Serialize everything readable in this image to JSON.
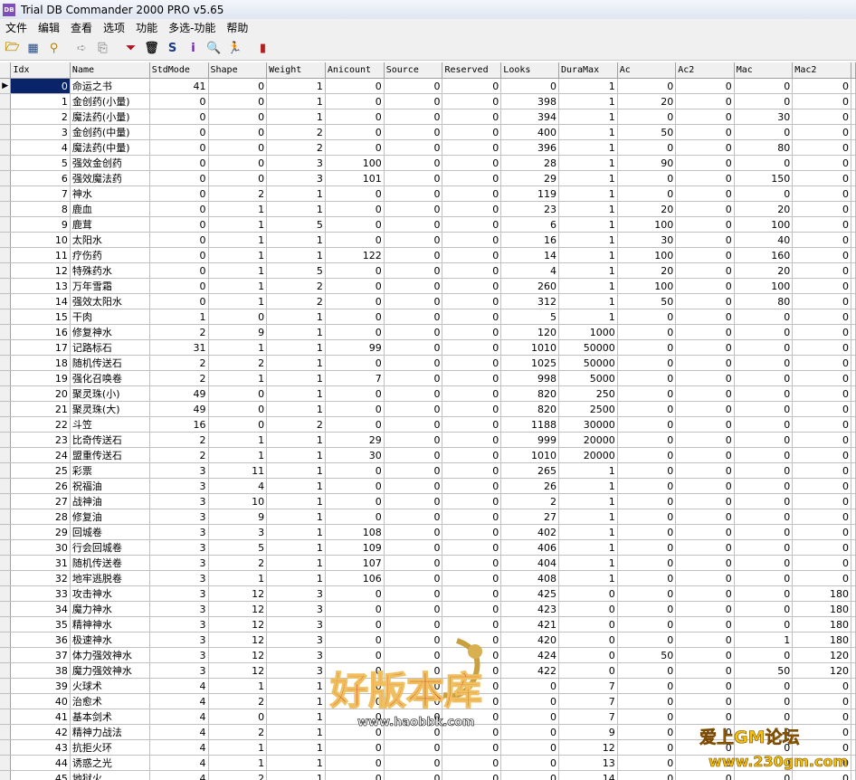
{
  "window": {
    "title": "Trial DB Commander 2000 PRO v5.65",
    "icon": "db-app-icon"
  },
  "menu": [
    "文件",
    "编辑",
    "查看",
    "选项",
    "功能",
    "多选-功能",
    "帮助"
  ],
  "toolbar": [
    {
      "name": "open-folder-icon",
      "glyph": "🗁",
      "color": "#c09000"
    },
    {
      "name": "table-icon",
      "glyph": "▦",
      "color": "#1a4a9a"
    },
    {
      "name": "binoculars-icon",
      "glyph": "⚲",
      "color": "#b08000"
    },
    {
      "name": "arrow-right-icon",
      "glyph": "➪",
      "color": "#a0a0a0"
    },
    {
      "name": "export-icon",
      "glyph": "⎘",
      "color": "#a0a0a0"
    },
    {
      "name": "funnel-icon",
      "glyph": "⏷",
      "color": "#b01020"
    },
    {
      "name": "trash-icon",
      "glyph": "🗑",
      "color": "#202020"
    },
    {
      "name": "sql-icon",
      "glyph": "S",
      "color": "#1a3a8a"
    },
    {
      "name": "info-icon",
      "glyph": "i",
      "color": "#7020b0"
    },
    {
      "name": "search-icon",
      "glyph": "🔍",
      "color": "#1a6a9a"
    },
    {
      "name": "runner-icon",
      "glyph": "🏃",
      "color": "#108030"
    },
    {
      "name": "book-icon",
      "glyph": "▮",
      "color": "#b02020"
    }
  ],
  "columns": [
    "Idx",
    "Name",
    "StdMode",
    "Shape",
    "Weight",
    "Anicount",
    "Source",
    "Reserved",
    "Looks",
    "DuraMax",
    "Ac",
    "Ac2",
    "Mac",
    "Mac2"
  ],
  "rows": [
    [
      "0",
      "命运之书",
      "41",
      "0",
      "1",
      "0",
      "0",
      "0",
      "0",
      "1",
      "0",
      "0",
      "0",
      "0"
    ],
    [
      "1",
      "金创药(小量)",
      "0",
      "0",
      "1",
      "0",
      "0",
      "0",
      "398",
      "1",
      "20",
      "0",
      "0",
      "0"
    ],
    [
      "2",
      "魔法药(小量)",
      "0",
      "0",
      "1",
      "0",
      "0",
      "0",
      "394",
      "1",
      "0",
      "0",
      "30",
      "0"
    ],
    [
      "3",
      "金创药(中量)",
      "0",
      "0",
      "2",
      "0",
      "0",
      "0",
      "400",
      "1",
      "50",
      "0",
      "0",
      "0"
    ],
    [
      "4",
      "魔法药(中量)",
      "0",
      "0",
      "2",
      "0",
      "0",
      "0",
      "396",
      "1",
      "0",
      "0",
      "80",
      "0"
    ],
    [
      "5",
      "强效金创药",
      "0",
      "0",
      "3",
      "100",
      "0",
      "0",
      "28",
      "1",
      "90",
      "0",
      "0",
      "0"
    ],
    [
      "6",
      "强效魔法药",
      "0",
      "0",
      "3",
      "101",
      "0",
      "0",
      "29",
      "1",
      "0",
      "0",
      "150",
      "0"
    ],
    [
      "7",
      "神水",
      "0",
      "2",
      "1",
      "0",
      "0",
      "0",
      "119",
      "1",
      "0",
      "0",
      "0",
      "0"
    ],
    [
      "8",
      "鹿血",
      "0",
      "1",
      "1",
      "0",
      "0",
      "0",
      "23",
      "1",
      "20",
      "0",
      "20",
      "0"
    ],
    [
      "9",
      "鹿茸",
      "0",
      "1",
      "5",
      "0",
      "0",
      "0",
      "6",
      "1",
      "100",
      "0",
      "100",
      "0"
    ],
    [
      "10",
      "太阳水",
      "0",
      "1",
      "1",
      "0",
      "0",
      "0",
      "16",
      "1",
      "30",
      "0",
      "40",
      "0"
    ],
    [
      "11",
      "疗伤药",
      "0",
      "1",
      "1",
      "122",
      "0",
      "0",
      "14",
      "1",
      "100",
      "0",
      "160",
      "0"
    ],
    [
      "12",
      "特殊药水",
      "0",
      "1",
      "5",
      "0",
      "0",
      "0",
      "4",
      "1",
      "20",
      "0",
      "20",
      "0"
    ],
    [
      "13",
      "万年雪霜",
      "0",
      "1",
      "2",
      "0",
      "0",
      "0",
      "260",
      "1",
      "100",
      "0",
      "100",
      "0"
    ],
    [
      "14",
      "强效太阳水",
      "0",
      "1",
      "2",
      "0",
      "0",
      "0",
      "312",
      "1",
      "50",
      "0",
      "80",
      "0"
    ],
    [
      "15",
      "干肉",
      "1",
      "0",
      "1",
      "0",
      "0",
      "0",
      "5",
      "1",
      "0",
      "0",
      "0",
      "0"
    ],
    [
      "16",
      "修复神水",
      "2",
      "9",
      "1",
      "0",
      "0",
      "0",
      "120",
      "1000",
      "0",
      "0",
      "0",
      "0"
    ],
    [
      "17",
      "记路标石",
      "31",
      "1",
      "1",
      "99",
      "0",
      "0",
      "1010",
      "50000",
      "0",
      "0",
      "0",
      "0"
    ],
    [
      "18",
      "随机传送石",
      "2",
      "2",
      "1",
      "0",
      "0",
      "0",
      "1025",
      "50000",
      "0",
      "0",
      "0",
      "0"
    ],
    [
      "19",
      "强化召唤卷",
      "2",
      "1",
      "1",
      "7",
      "0",
      "0",
      "998",
      "5000",
      "0",
      "0",
      "0",
      "0"
    ],
    [
      "20",
      "聚灵珠(小)",
      "49",
      "0",
      "1",
      "0",
      "0",
      "0",
      "820",
      "250",
      "0",
      "0",
      "0",
      "0"
    ],
    [
      "21",
      "聚灵珠(大)",
      "49",
      "0",
      "1",
      "0",
      "0",
      "0",
      "820",
      "2500",
      "0",
      "0",
      "0",
      "0"
    ],
    [
      "22",
      "斗笠",
      "16",
      "0",
      "2",
      "0",
      "0",
      "0",
      "1188",
      "30000",
      "0",
      "0",
      "0",
      "0"
    ],
    [
      "23",
      "比奇传送石",
      "2",
      "1",
      "1",
      "29",
      "0",
      "0",
      "999",
      "20000",
      "0",
      "0",
      "0",
      "0"
    ],
    [
      "24",
      "盟重传送石",
      "2",
      "1",
      "1",
      "30",
      "0",
      "0",
      "1010",
      "20000",
      "0",
      "0",
      "0",
      "0"
    ],
    [
      "25",
      "彩票",
      "3",
      "11",
      "1",
      "0",
      "0",
      "0",
      "265",
      "1",
      "0",
      "0",
      "0",
      "0"
    ],
    [
      "26",
      "祝福油",
      "3",
      "4",
      "1",
      "0",
      "0",
      "0",
      "26",
      "1",
      "0",
      "0",
      "0",
      "0"
    ],
    [
      "27",
      "战神油",
      "3",
      "10",
      "1",
      "0",
      "0",
      "0",
      "2",
      "1",
      "0",
      "0",
      "0",
      "0"
    ],
    [
      "28",
      "修复油",
      "3",
      "9",
      "1",
      "0",
      "0",
      "0",
      "27",
      "1",
      "0",
      "0",
      "0",
      "0"
    ],
    [
      "29",
      "回城卷",
      "3",
      "3",
      "1",
      "108",
      "0",
      "0",
      "402",
      "1",
      "0",
      "0",
      "0",
      "0"
    ],
    [
      "30",
      "行会回城卷",
      "3",
      "5",
      "1",
      "109",
      "0",
      "0",
      "406",
      "1",
      "0",
      "0",
      "0",
      "0"
    ],
    [
      "31",
      "随机传送卷",
      "3",
      "2",
      "1",
      "107",
      "0",
      "0",
      "404",
      "1",
      "0",
      "0",
      "0",
      "0"
    ],
    [
      "32",
      "地牢逃脱卷",
      "3",
      "1",
      "1",
      "106",
      "0",
      "0",
      "408",
      "1",
      "0",
      "0",
      "0",
      "0"
    ],
    [
      "33",
      "攻击神水",
      "3",
      "12",
      "3",
      "0",
      "0",
      "0",
      "425",
      "0",
      "0",
      "0",
      "0",
      "180"
    ],
    [
      "34",
      "魔力神水",
      "3",
      "12",
      "3",
      "0",
      "0",
      "0",
      "423",
      "0",
      "0",
      "0",
      "0",
      "180"
    ],
    [
      "35",
      "精神神水",
      "3",
      "12",
      "3",
      "0",
      "0",
      "0",
      "421",
      "0",
      "0",
      "0",
      "0",
      "180"
    ],
    [
      "36",
      "极速神水",
      "3",
      "12",
      "3",
      "0",
      "0",
      "0",
      "420",
      "0",
      "0",
      "0",
      "1",
      "180"
    ],
    [
      "37",
      "体力强效神水",
      "3",
      "12",
      "3",
      "0",
      "0",
      "0",
      "424",
      "0",
      "50",
      "0",
      "0",
      "120"
    ],
    [
      "38",
      "魔力强效神水",
      "3",
      "12",
      "3",
      "0",
      "0",
      "0",
      "422",
      "0",
      "0",
      "0",
      "50",
      "120"
    ],
    [
      "39",
      "火球术",
      "4",
      "1",
      "1",
      "0",
      "0",
      "0",
      "0",
      "7",
      "0",
      "0",
      "0",
      "0"
    ],
    [
      "40",
      "治愈术",
      "4",
      "2",
      "1",
      "0",
      "0",
      "0",
      "0",
      "7",
      "0",
      "0",
      "0",
      "0"
    ],
    [
      "41",
      "基本剑术",
      "4",
      "0",
      "1",
      "0",
      "0",
      "0",
      "0",
      "7",
      "0",
      "0",
      "0",
      "0"
    ],
    [
      "42",
      "精神力战法",
      "4",
      "2",
      "1",
      "0",
      "0",
      "0",
      "0",
      "9",
      "0",
      "0",
      "0",
      "0"
    ],
    [
      "43",
      "抗拒火环",
      "4",
      "1",
      "1",
      "0",
      "0",
      "0",
      "0",
      "12",
      "0",
      "0",
      "0",
      "0"
    ],
    [
      "44",
      "诱惑之光",
      "4",
      "1",
      "1",
      "0",
      "0",
      "0",
      "0",
      "13",
      "0",
      "0",
      "0",
      "0"
    ],
    [
      "45",
      "地狱火",
      "4",
      "2",
      "1",
      "0",
      "0",
      "0",
      "0",
      "14",
      "0",
      "0",
      "0",
      "0"
    ]
  ],
  "watermarks": {
    "center_text": "好版本库",
    "center_url": "www.haobbk.com",
    "corner_text": "爱上GM论坛",
    "corner_url": "www.230gm.com"
  },
  "colors": {
    "selection": "#0a246a",
    "grid_line": "#c0c0c0",
    "header_bg": "#f0f0f0"
  }
}
